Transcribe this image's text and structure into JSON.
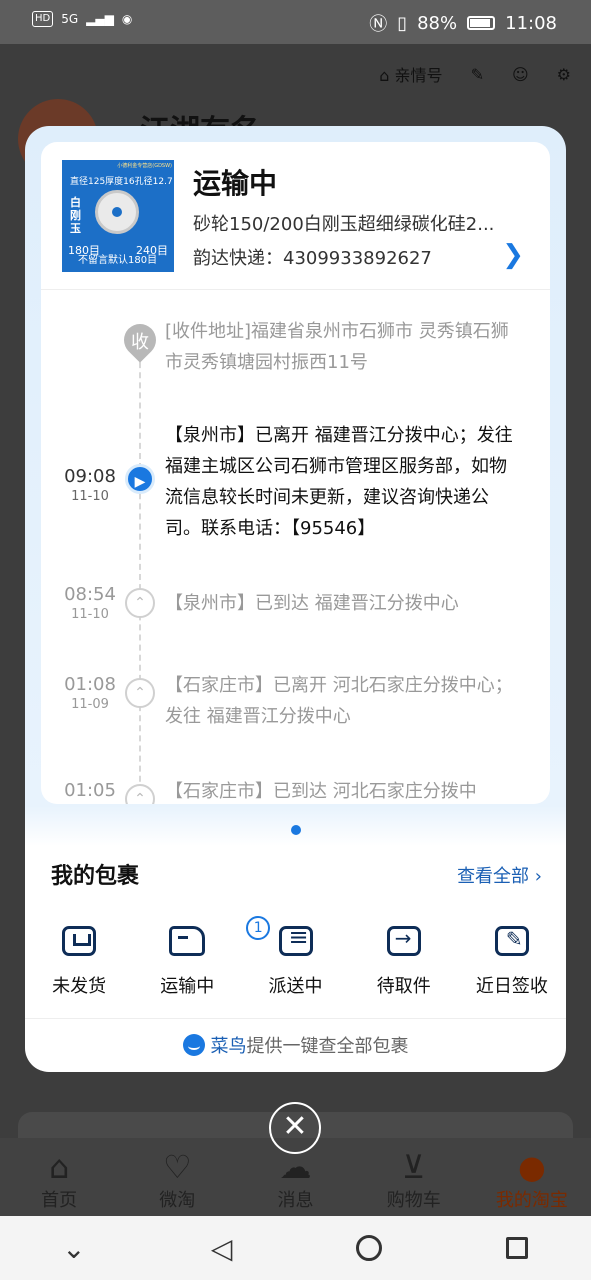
{
  "status_bar": {
    "network": "5G",
    "battery": "88%",
    "time": "11:08",
    "hd": "HD"
  },
  "background": {
    "toolbar": {
      "family_label": "亲情号"
    },
    "username": "江湖有名",
    "tabs": [
      {
        "label": "首页",
        "icon": "home-icon"
      },
      {
        "label": "微淘",
        "icon": "broadcast-icon"
      },
      {
        "label": "消息",
        "icon": "message-icon"
      },
      {
        "label": "购物车",
        "icon": "cart-icon"
      },
      {
        "label": "我的淘宝",
        "icon": "profile-icon"
      }
    ]
  },
  "package": {
    "status": "运输中",
    "product_name": "砂轮150/200白刚玉超细绿碳化硅2...",
    "tracking": "韵达快递：4309933892627",
    "thumbnail": {
      "corner": "小德利金专营店(GDSW)",
      "spec": "直径125厚度16孔径12.7",
      "material": "白刚玉",
      "grit_left": "180目",
      "grit_right": "240目",
      "note": "不留言默认180目"
    }
  },
  "timeline": {
    "receiver": {
      "node_char": "收",
      "text": "[收件地址]福建省泉州市石狮市 灵秀镇石狮市灵秀镇塘园村振西11号"
    },
    "events": [
      {
        "time": "09:08",
        "date": "11-10",
        "text": "【泉州市】已离开 福建晋江分拨中心；发往 福建主城区公司石狮市管理区服务部，如物流信息较长时间未更新，建议咨询快递公司。联系电话：【95546】"
      },
      {
        "time": "08:54",
        "date": "11-10",
        "text": "【泉州市】已到达 福建晋江分拨中心"
      },
      {
        "time": "01:08",
        "date": "11-09",
        "text": "【石家庄市】已离开 河北石家庄分拨中心；发往 福建晋江分拨中心"
      },
      {
        "time": "01:05",
        "date": "",
        "text": "【石家庄市】已到达 河北石家庄分拨中"
      }
    ]
  },
  "my_packages": {
    "title": "我的包裹",
    "view_all": "查看全部",
    "shortcuts": [
      {
        "label": "未发货",
        "icon": "unshipped-icon"
      },
      {
        "label": "运输中",
        "icon": "in-transit-icon",
        "badge": "1"
      },
      {
        "label": "派送中",
        "icon": "delivering-icon"
      },
      {
        "label": "待取件",
        "icon": "pickup-icon"
      },
      {
        "label": "近日签收",
        "icon": "signed-icon"
      }
    ],
    "footer_brand": "菜鸟",
    "footer_text": "提供一键查全部包裹"
  }
}
